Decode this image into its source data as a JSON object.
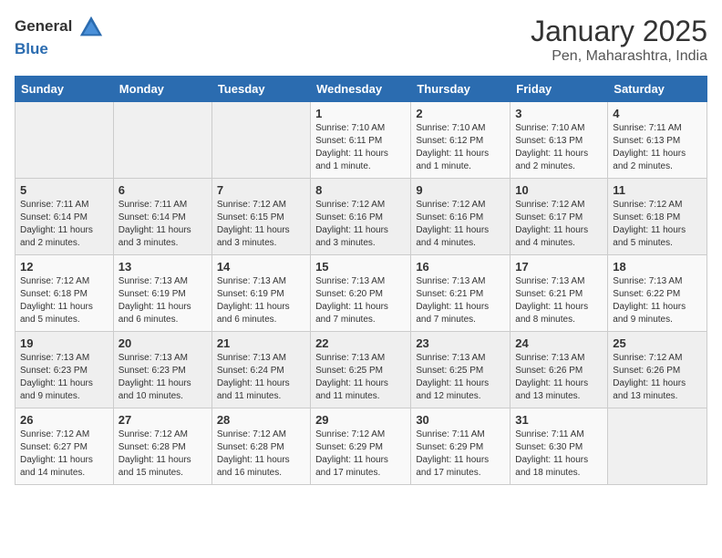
{
  "header": {
    "logo_general": "General",
    "logo_blue": "Blue",
    "month": "January 2025",
    "location": "Pen, Maharashtra, India"
  },
  "days_of_week": [
    "Sunday",
    "Monday",
    "Tuesday",
    "Wednesday",
    "Thursday",
    "Friday",
    "Saturday"
  ],
  "weeks": [
    [
      {
        "day": "",
        "sunrise": "",
        "sunset": "",
        "daylight": ""
      },
      {
        "day": "",
        "sunrise": "",
        "sunset": "",
        "daylight": ""
      },
      {
        "day": "",
        "sunrise": "",
        "sunset": "",
        "daylight": ""
      },
      {
        "day": "1",
        "sunrise": "Sunrise: 7:10 AM",
        "sunset": "Sunset: 6:11 PM",
        "daylight": "Daylight: 11 hours and 1 minute."
      },
      {
        "day": "2",
        "sunrise": "Sunrise: 7:10 AM",
        "sunset": "Sunset: 6:12 PM",
        "daylight": "Daylight: 11 hours and 1 minute."
      },
      {
        "day": "3",
        "sunrise": "Sunrise: 7:10 AM",
        "sunset": "Sunset: 6:13 PM",
        "daylight": "Daylight: 11 hours and 2 minutes."
      },
      {
        "day": "4",
        "sunrise": "Sunrise: 7:11 AM",
        "sunset": "Sunset: 6:13 PM",
        "daylight": "Daylight: 11 hours and 2 minutes."
      }
    ],
    [
      {
        "day": "5",
        "sunrise": "Sunrise: 7:11 AM",
        "sunset": "Sunset: 6:14 PM",
        "daylight": "Daylight: 11 hours and 2 minutes."
      },
      {
        "day": "6",
        "sunrise": "Sunrise: 7:11 AM",
        "sunset": "Sunset: 6:14 PM",
        "daylight": "Daylight: 11 hours and 3 minutes."
      },
      {
        "day": "7",
        "sunrise": "Sunrise: 7:12 AM",
        "sunset": "Sunset: 6:15 PM",
        "daylight": "Daylight: 11 hours and 3 minutes."
      },
      {
        "day": "8",
        "sunrise": "Sunrise: 7:12 AM",
        "sunset": "Sunset: 6:16 PM",
        "daylight": "Daylight: 11 hours and 3 minutes."
      },
      {
        "day": "9",
        "sunrise": "Sunrise: 7:12 AM",
        "sunset": "Sunset: 6:16 PM",
        "daylight": "Daylight: 11 hours and 4 minutes."
      },
      {
        "day": "10",
        "sunrise": "Sunrise: 7:12 AM",
        "sunset": "Sunset: 6:17 PM",
        "daylight": "Daylight: 11 hours and 4 minutes."
      },
      {
        "day": "11",
        "sunrise": "Sunrise: 7:12 AM",
        "sunset": "Sunset: 6:18 PM",
        "daylight": "Daylight: 11 hours and 5 minutes."
      }
    ],
    [
      {
        "day": "12",
        "sunrise": "Sunrise: 7:12 AM",
        "sunset": "Sunset: 6:18 PM",
        "daylight": "Daylight: 11 hours and 5 minutes."
      },
      {
        "day": "13",
        "sunrise": "Sunrise: 7:13 AM",
        "sunset": "Sunset: 6:19 PM",
        "daylight": "Daylight: 11 hours and 6 minutes."
      },
      {
        "day": "14",
        "sunrise": "Sunrise: 7:13 AM",
        "sunset": "Sunset: 6:19 PM",
        "daylight": "Daylight: 11 hours and 6 minutes."
      },
      {
        "day": "15",
        "sunrise": "Sunrise: 7:13 AM",
        "sunset": "Sunset: 6:20 PM",
        "daylight": "Daylight: 11 hours and 7 minutes."
      },
      {
        "day": "16",
        "sunrise": "Sunrise: 7:13 AM",
        "sunset": "Sunset: 6:21 PM",
        "daylight": "Daylight: 11 hours and 7 minutes."
      },
      {
        "day": "17",
        "sunrise": "Sunrise: 7:13 AM",
        "sunset": "Sunset: 6:21 PM",
        "daylight": "Daylight: 11 hours and 8 minutes."
      },
      {
        "day": "18",
        "sunrise": "Sunrise: 7:13 AM",
        "sunset": "Sunset: 6:22 PM",
        "daylight": "Daylight: 11 hours and 9 minutes."
      }
    ],
    [
      {
        "day": "19",
        "sunrise": "Sunrise: 7:13 AM",
        "sunset": "Sunset: 6:23 PM",
        "daylight": "Daylight: 11 hours and 9 minutes."
      },
      {
        "day": "20",
        "sunrise": "Sunrise: 7:13 AM",
        "sunset": "Sunset: 6:23 PM",
        "daylight": "Daylight: 11 hours and 10 minutes."
      },
      {
        "day": "21",
        "sunrise": "Sunrise: 7:13 AM",
        "sunset": "Sunset: 6:24 PM",
        "daylight": "Daylight: 11 hours and 11 minutes."
      },
      {
        "day": "22",
        "sunrise": "Sunrise: 7:13 AM",
        "sunset": "Sunset: 6:25 PM",
        "daylight": "Daylight: 11 hours and 11 minutes."
      },
      {
        "day": "23",
        "sunrise": "Sunrise: 7:13 AM",
        "sunset": "Sunset: 6:25 PM",
        "daylight": "Daylight: 11 hours and 12 minutes."
      },
      {
        "day": "24",
        "sunrise": "Sunrise: 7:13 AM",
        "sunset": "Sunset: 6:26 PM",
        "daylight": "Daylight: 11 hours and 13 minutes."
      },
      {
        "day": "25",
        "sunrise": "Sunrise: 7:12 AM",
        "sunset": "Sunset: 6:26 PM",
        "daylight": "Daylight: 11 hours and 13 minutes."
      }
    ],
    [
      {
        "day": "26",
        "sunrise": "Sunrise: 7:12 AM",
        "sunset": "Sunset: 6:27 PM",
        "daylight": "Daylight: 11 hours and 14 minutes."
      },
      {
        "day": "27",
        "sunrise": "Sunrise: 7:12 AM",
        "sunset": "Sunset: 6:28 PM",
        "daylight": "Daylight: 11 hours and 15 minutes."
      },
      {
        "day": "28",
        "sunrise": "Sunrise: 7:12 AM",
        "sunset": "Sunset: 6:28 PM",
        "daylight": "Daylight: 11 hours and 16 minutes."
      },
      {
        "day": "29",
        "sunrise": "Sunrise: 7:12 AM",
        "sunset": "Sunset: 6:29 PM",
        "daylight": "Daylight: 11 hours and 17 minutes."
      },
      {
        "day": "30",
        "sunrise": "Sunrise: 7:11 AM",
        "sunset": "Sunset: 6:29 PM",
        "daylight": "Daylight: 11 hours and 17 minutes."
      },
      {
        "day": "31",
        "sunrise": "Sunrise: 7:11 AM",
        "sunset": "Sunset: 6:30 PM",
        "daylight": "Daylight: 11 hours and 18 minutes."
      },
      {
        "day": "",
        "sunrise": "",
        "sunset": "",
        "daylight": ""
      }
    ]
  ]
}
